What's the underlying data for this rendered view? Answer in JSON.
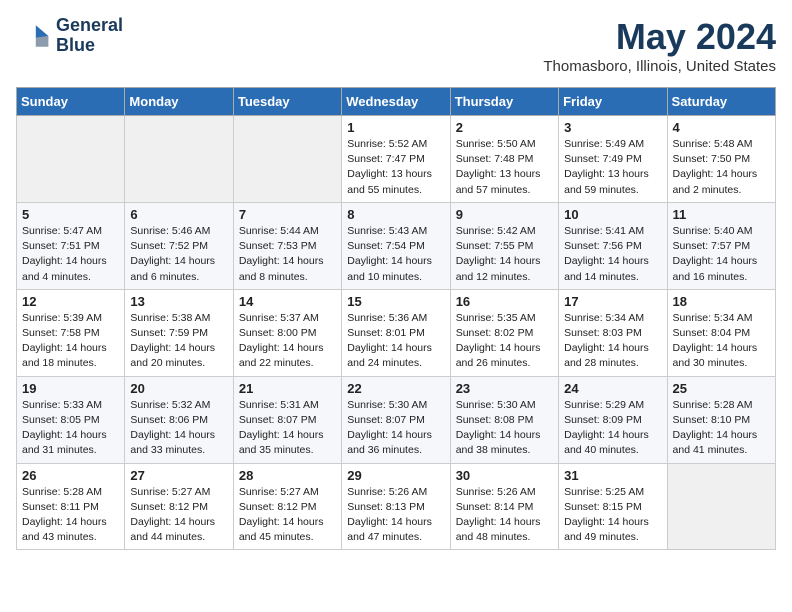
{
  "header": {
    "logo_line1": "General",
    "logo_line2": "Blue",
    "month": "May 2024",
    "location": "Thomasboro, Illinois, United States"
  },
  "weekdays": [
    "Sunday",
    "Monday",
    "Tuesday",
    "Wednesday",
    "Thursday",
    "Friday",
    "Saturday"
  ],
  "weeks": [
    [
      {
        "day": "",
        "empty": true
      },
      {
        "day": "",
        "empty": true
      },
      {
        "day": "",
        "empty": true
      },
      {
        "day": "1",
        "sunrise": "5:52 AM",
        "sunset": "7:47 PM",
        "daylight": "13 hours and 55 minutes."
      },
      {
        "day": "2",
        "sunrise": "5:50 AM",
        "sunset": "7:48 PM",
        "daylight": "13 hours and 57 minutes."
      },
      {
        "day": "3",
        "sunrise": "5:49 AM",
        "sunset": "7:49 PM",
        "daylight": "13 hours and 59 minutes."
      },
      {
        "day": "4",
        "sunrise": "5:48 AM",
        "sunset": "7:50 PM",
        "daylight": "14 hours and 2 minutes."
      }
    ],
    [
      {
        "day": "5",
        "sunrise": "5:47 AM",
        "sunset": "7:51 PM",
        "daylight": "14 hours and 4 minutes."
      },
      {
        "day": "6",
        "sunrise": "5:46 AM",
        "sunset": "7:52 PM",
        "daylight": "14 hours and 6 minutes."
      },
      {
        "day": "7",
        "sunrise": "5:44 AM",
        "sunset": "7:53 PM",
        "daylight": "14 hours and 8 minutes."
      },
      {
        "day": "8",
        "sunrise": "5:43 AM",
        "sunset": "7:54 PM",
        "daylight": "14 hours and 10 minutes."
      },
      {
        "day": "9",
        "sunrise": "5:42 AM",
        "sunset": "7:55 PM",
        "daylight": "14 hours and 12 minutes."
      },
      {
        "day": "10",
        "sunrise": "5:41 AM",
        "sunset": "7:56 PM",
        "daylight": "14 hours and 14 minutes."
      },
      {
        "day": "11",
        "sunrise": "5:40 AM",
        "sunset": "7:57 PM",
        "daylight": "14 hours and 16 minutes."
      }
    ],
    [
      {
        "day": "12",
        "sunrise": "5:39 AM",
        "sunset": "7:58 PM",
        "daylight": "14 hours and 18 minutes."
      },
      {
        "day": "13",
        "sunrise": "5:38 AM",
        "sunset": "7:59 PM",
        "daylight": "14 hours and 20 minutes."
      },
      {
        "day": "14",
        "sunrise": "5:37 AM",
        "sunset": "8:00 PM",
        "daylight": "14 hours and 22 minutes."
      },
      {
        "day": "15",
        "sunrise": "5:36 AM",
        "sunset": "8:01 PM",
        "daylight": "14 hours and 24 minutes."
      },
      {
        "day": "16",
        "sunrise": "5:35 AM",
        "sunset": "8:02 PM",
        "daylight": "14 hours and 26 minutes."
      },
      {
        "day": "17",
        "sunrise": "5:34 AM",
        "sunset": "8:03 PM",
        "daylight": "14 hours and 28 minutes."
      },
      {
        "day": "18",
        "sunrise": "5:34 AM",
        "sunset": "8:04 PM",
        "daylight": "14 hours and 30 minutes."
      }
    ],
    [
      {
        "day": "19",
        "sunrise": "5:33 AM",
        "sunset": "8:05 PM",
        "daylight": "14 hours and 31 minutes."
      },
      {
        "day": "20",
        "sunrise": "5:32 AM",
        "sunset": "8:06 PM",
        "daylight": "14 hours and 33 minutes."
      },
      {
        "day": "21",
        "sunrise": "5:31 AM",
        "sunset": "8:07 PM",
        "daylight": "14 hours and 35 minutes."
      },
      {
        "day": "22",
        "sunrise": "5:30 AM",
        "sunset": "8:07 PM",
        "daylight": "14 hours and 36 minutes."
      },
      {
        "day": "23",
        "sunrise": "5:30 AM",
        "sunset": "8:08 PM",
        "daylight": "14 hours and 38 minutes."
      },
      {
        "day": "24",
        "sunrise": "5:29 AM",
        "sunset": "8:09 PM",
        "daylight": "14 hours and 40 minutes."
      },
      {
        "day": "25",
        "sunrise": "5:28 AM",
        "sunset": "8:10 PM",
        "daylight": "14 hours and 41 minutes."
      }
    ],
    [
      {
        "day": "26",
        "sunrise": "5:28 AM",
        "sunset": "8:11 PM",
        "daylight": "14 hours and 43 minutes."
      },
      {
        "day": "27",
        "sunrise": "5:27 AM",
        "sunset": "8:12 PM",
        "daylight": "14 hours and 44 minutes."
      },
      {
        "day": "28",
        "sunrise": "5:27 AM",
        "sunset": "8:12 PM",
        "daylight": "14 hours and 45 minutes."
      },
      {
        "day": "29",
        "sunrise": "5:26 AM",
        "sunset": "8:13 PM",
        "daylight": "14 hours and 47 minutes."
      },
      {
        "day": "30",
        "sunrise": "5:26 AM",
        "sunset": "8:14 PM",
        "daylight": "14 hours and 48 minutes."
      },
      {
        "day": "31",
        "sunrise": "5:25 AM",
        "sunset": "8:15 PM",
        "daylight": "14 hours and 49 minutes."
      },
      {
        "day": "",
        "empty": true
      }
    ]
  ]
}
